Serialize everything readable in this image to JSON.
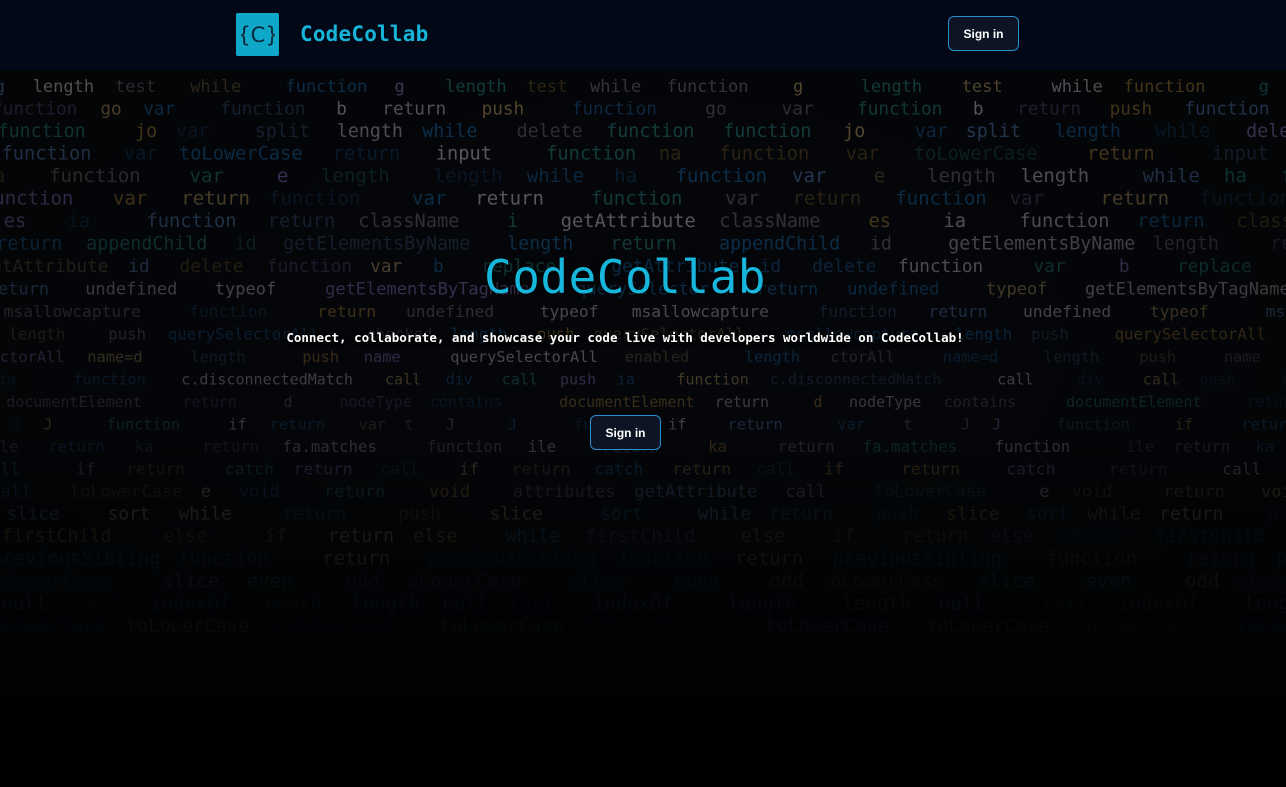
{
  "navbar": {
    "brand_name": "CodeCollab",
    "logo_glyph": "{C}",
    "signin_label": "Sign in"
  },
  "hero": {
    "title": "CodeCollab",
    "subtitle": "Connect, collaborate, and showcase your code live with developers worldwide on CodeCollab!",
    "signin_label": "Sign in"
  },
  "colors": {
    "navbar_bg": "#020816",
    "accent": "#16b4d8",
    "button_border": "#2a8fd2",
    "page_bg": "#000000"
  },
  "background_code": [
    "g length test while function",
    "function go var function b return push",
    "function jo var split length while delete function",
    "function var toLowerCase return input function na",
    "ha function var e length length while",
    "function var return",
    "es ia function return className i getAttribute className",
    "return appendChild id getElementsByName length",
    "getAttribute id delete function var b replace",
    "return undefined typeof getElementsByTagName querySelector",
    "msallowcapture function return undefined typeof",
    "length push querySelectorAll checked length push querySelectorAll msallowcapture",
    "ctorAll name=d length push name querySelectorAll enabled length",
    "ia function c.disconnectedMatch call div call push",
    "documentElement return d nodeType contains",
    "t J J function if return var",
    "ile return ka return fa.matches function",
    "call if return catch return",
    "call toLowerCase e void return void attributes getAttribute",
    "slice sort while return push",
    "firstChild else if return else while",
    "previousSibling function return",
    "oLowerCase slice even odd",
    "null text indexOf length length",
    "toLowerCase"
  ]
}
